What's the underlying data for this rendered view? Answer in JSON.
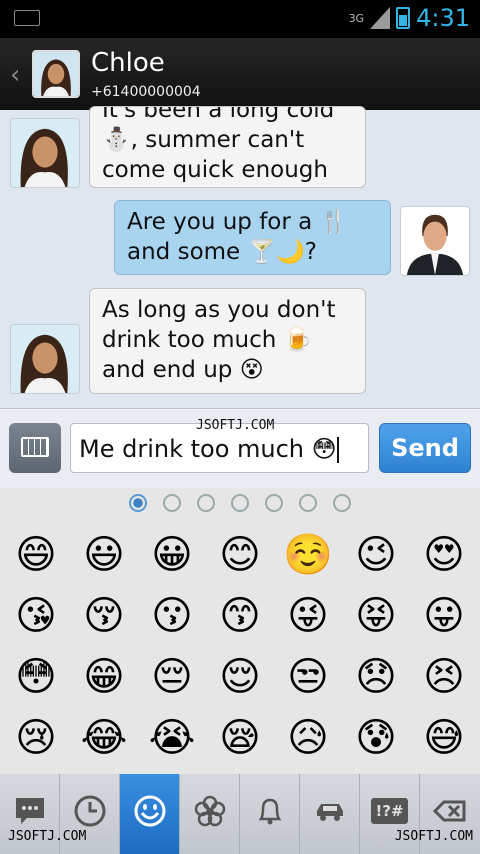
{
  "status_bar": {
    "network": "3G",
    "time": "4:31"
  },
  "header": {
    "contact_name": "Chloe",
    "contact_number": "+61400000004"
  },
  "messages": [
    {
      "direction": "in",
      "lines": [
        "It's been a long cold",
        "⛄, summer can't",
        "come quick enough"
      ]
    },
    {
      "direction": "out",
      "lines": [
        "Are you up for a 🍴",
        "and some 🍸🌙?"
      ]
    },
    {
      "direction": "in",
      "lines": [
        "As long as you don't",
        "drink too much 🍺",
        "and end up 😵"
      ]
    }
  ],
  "compose": {
    "input_value": "Me drink too much 😳",
    "send_label": "Send",
    "watermark": "JSOFTJ.COM"
  },
  "emoji_panel": {
    "page_count": 7,
    "active_page": 1,
    "emojis": [
      "😄",
      "😃",
      "😀",
      "😊",
      "☺️",
      "😉",
      "😍",
      "😘",
      "😚",
      "😗",
      "😙",
      "😜",
      "😝",
      "😛",
      "😳",
      "😁",
      "😔",
      "😌",
      "😒",
      "😞",
      "😣",
      "😢",
      "😂",
      "😭",
      "😪",
      "😥",
      "😰",
      "😅"
    ]
  },
  "categories": {
    "items": [
      "chat-bubble",
      "recent",
      "smileys",
      "flower",
      "bell",
      "car",
      "symbols",
      "backspace"
    ],
    "active": "smileys",
    "symbols_label": "!?#",
    "watermark_left": "JSOFTJ.COM",
    "watermark_right": "JSOFTJ.COM"
  },
  "colors": {
    "accent": "#33b5e5",
    "send": "#3a8fe0",
    "outgoing_bubble": "#a8d4f0"
  }
}
